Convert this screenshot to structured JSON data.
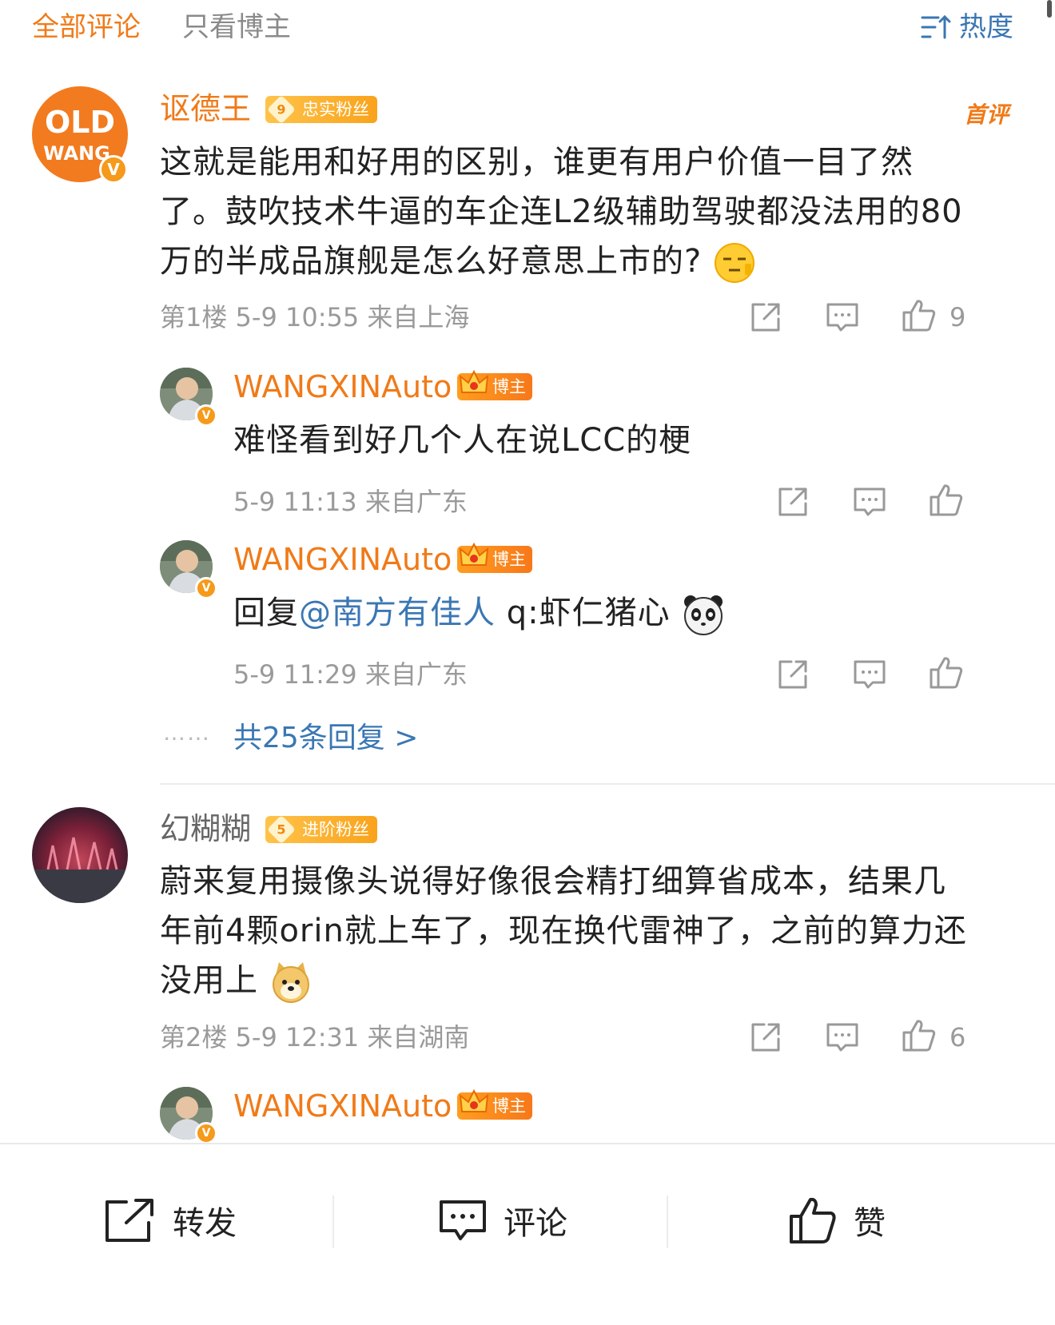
{
  "header": {
    "tab_all": "全部评论",
    "tab_author": "只看博主",
    "sort_label": "热度",
    "sort_icon": "sort-icon"
  },
  "comments": [
    {
      "user": "讴德王",
      "fan_level": "9",
      "fan_label": "忠实粉丝",
      "first_comment_tag": "首评",
      "text_before": "这就是能用和好用的区别，谁更有用户价值一目了然了。鼓吹技术牛逼的车企连L2级辅助驾驶都没法用的80万的半成品旗舰是怎么好意思上市的?",
      "emoji": "sleepy-face-emoji",
      "meta": "第1楼 5-9 10:55 来自上海",
      "likes": "9",
      "replies": [
        {
          "user": "WANGXINAuto",
          "host_label": "博主",
          "text": "难怪看到好几个人在说LCC的梗",
          "meta": "5-9 11:13 来自广东"
        },
        {
          "user": "WANGXINAuto",
          "host_label": "博主",
          "reply_prefix": "回复",
          "mention": "@南方有佳人",
          "text": " q:虾仁猪心",
          "emoji": "panda-emoji",
          "meta": "5-9 11:29 来自广东"
        }
      ],
      "dots": "……",
      "more_replies": "共25条回复 >"
    },
    {
      "user": "幻糊糊",
      "fan_level": "5",
      "fan_label": "进阶粉丝",
      "text_before": "蔚来复用摄像头说得好像很会精打细算省成本，结果几年前4颗orin就上车了，现在换代雷神了，之前的算力还没用上",
      "emoji": "doge-emoji",
      "meta": "第2楼 5-9 12:31 来自湖南",
      "likes": "6",
      "replies": [
        {
          "user": "WANGXINAuto",
          "host_label": "博主"
        }
      ]
    }
  ],
  "bottom_bar": {
    "repost_label": "转发",
    "comment_label": "评论",
    "like_label": "赞"
  },
  "colors": {
    "accent_orange": "#f07a18",
    "link_blue": "#3a77b4",
    "meta_gray": "#9a9a9a"
  }
}
